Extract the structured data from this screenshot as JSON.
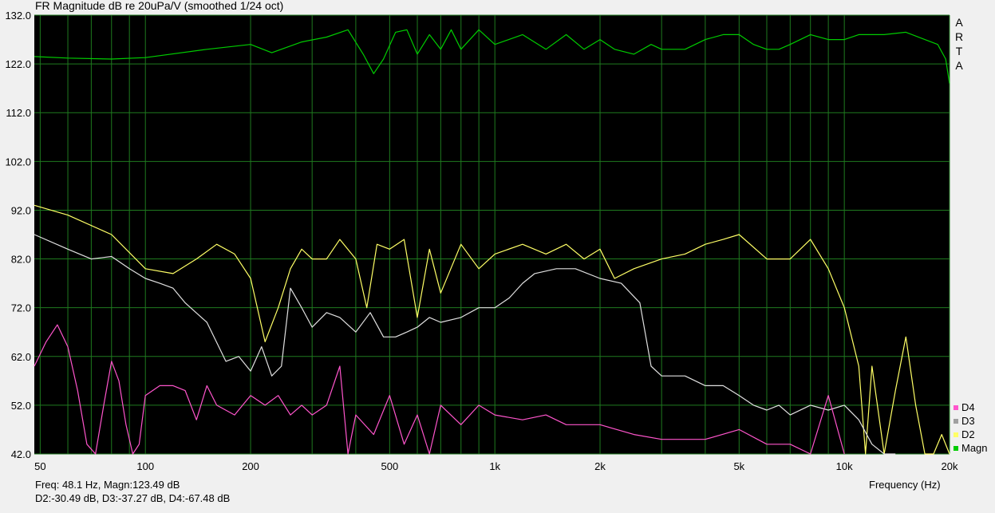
{
  "title": "FR Magnitude dB re 20uPa/V (smoothed 1/24 oct)",
  "brand_letters": [
    "A",
    "R",
    "T",
    "A"
  ],
  "readout": {
    "line1": "Freq: 48.1 Hz, Magn:123.49 dB",
    "line2": "D2:-30.49 dB, D3:-37.27 dB, D4:-67.48 dB"
  },
  "legend": [
    {
      "label": "D4",
      "color": "#ff55cc"
    },
    {
      "label": "D3",
      "color": "#a0a0a0"
    },
    {
      "label": "D2",
      "color": "#ffff66"
    },
    {
      "label": "Magn",
      "color": "#00cc00"
    }
  ],
  "chart_data": {
    "type": "line",
    "title": "FR Magnitude dB re 20uPa/V (smoothed 1/24 oct)",
    "xlabel": "Frequency (Hz)",
    "ylabel": "",
    "xscale": "log",
    "xlim": [
      48.1,
      20000
    ],
    "ylim": [
      42,
      132
    ],
    "grid": true,
    "yticks": [
      "132.0",
      "122.0",
      "112.0",
      "102.0",
      "92.0",
      "82.0",
      "72.0",
      "62.0",
      "52.0",
      "42.0"
    ],
    "ytick_values": [
      132,
      122,
      112,
      102,
      92,
      82,
      72,
      62,
      52,
      42
    ],
    "xticks": [
      {
        "value": 50,
        "label": "50"
      },
      {
        "value": 100,
        "label": "100"
      },
      {
        "value": 200,
        "label": "200"
      },
      {
        "value": 500,
        "label": "500"
      },
      {
        "value": 1000,
        "label": "1k"
      },
      {
        "value": 2000,
        "label": "2k"
      },
      {
        "value": 5000,
        "label": "5k"
      },
      {
        "value": 10000,
        "label": "10k"
      },
      {
        "value": 20000,
        "label": "20k"
      }
    ],
    "colors": {
      "background": "#000000",
      "grid": "#1f7a1f"
    },
    "series": [
      {
        "name": "Magn",
        "color": "#00cc00",
        "x": [
          48.1,
          60,
          80,
          100,
          150,
          200,
          230,
          280,
          330,
          380,
          420,
          450,
          480,
          520,
          560,
          600,
          650,
          700,
          750,
          800,
          900,
          1000,
          1200,
          1400,
          1600,
          1800,
          2000,
          2200,
          2500,
          2800,
          3000,
          3500,
          4000,
          4500,
          5000,
          5500,
          6000,
          6500,
          7000,
          8000,
          9000,
          10000,
          11000,
          12000,
          13000,
          15000,
          17000,
          18500,
          19500,
          20000
        ],
        "y": [
          123.5,
          123.2,
          123,
          123.3,
          125,
          126,
          124.3,
          126.5,
          127.5,
          129,
          124,
          120,
          123,
          128.5,
          129,
          124,
          128,
          125,
          129,
          125,
          129,
          126,
          128,
          125,
          128,
          125,
          127,
          125,
          124,
          126,
          125,
          125,
          127,
          128,
          128,
          126,
          125,
          125,
          126,
          128,
          127,
          127,
          128,
          128,
          128,
          128.5,
          127,
          126,
          123,
          118
        ]
      },
      {
        "name": "D2",
        "color": "#ffff66",
        "x": [
          48.1,
          60,
          80,
          100,
          120,
          140,
          160,
          180,
          200,
          220,
          240,
          260,
          280,
          300,
          330,
          360,
          400,
          430,
          460,
          500,
          550,
          600,
          650,
          700,
          800,
          900,
          1000,
          1200,
          1400,
          1600,
          1800,
          2000,
          2200,
          2500,
          3000,
          3500,
          4000,
          4500,
          5000,
          6000,
          7000,
          8000,
          9000,
          10000,
          11000,
          11500,
          12000,
          13000,
          14000,
          15000,
          16000,
          17000,
          18000,
          19000,
          20000
        ],
        "y": [
          93,
          91,
          87,
          80,
          79,
          82,
          85,
          83,
          78,
          65,
          72,
          80,
          84,
          82,
          82,
          86,
          82,
          72,
          85,
          84,
          86,
          70,
          84,
          75,
          85,
          80,
          83,
          85,
          83,
          85,
          82,
          84,
          78,
          80,
          82,
          83,
          85,
          86,
          87,
          82,
          82,
          86,
          80,
          72,
          60,
          40,
          60,
          42,
          55,
          66,
          52,
          42,
          40,
          46,
          42
        ]
      },
      {
        "name": "D3",
        "color": "#e0e0e0",
        "x": [
          48.1,
          60,
          70,
          80,
          90,
          100,
          110,
          120,
          130,
          150,
          170,
          185,
          200,
          215,
          230,
          245,
          260,
          280,
          300,
          330,
          360,
          400,
          440,
          480,
          520,
          560,
          600,
          650,
          700,
          800,
          900,
          1000,
          1100,
          1200,
          1300,
          1500,
          1700,
          2000,
          2300,
          2600,
          2800,
          3000,
          3500,
          4000,
          4500,
          5000,
          5500,
          6000,
          6500,
          7000,
          8000,
          9000,
          10000,
          11000,
          12000,
          13000,
          14000
        ],
        "y": [
          87,
          84,
          82,
          82.5,
          80,
          78,
          77,
          76,
          73,
          69,
          61,
          62,
          59,
          64,
          58,
          60,
          76,
          72,
          68,
          71,
          70,
          67,
          71,
          66,
          66,
          67,
          68,
          70,
          69,
          70,
          72,
          72,
          74,
          77,
          79,
          80,
          80,
          78,
          77,
          73,
          60,
          58,
          58,
          56,
          56,
          54,
          52,
          51,
          52,
          50,
          52,
          51,
          52,
          49,
          44,
          42,
          41
        ]
      },
      {
        "name": "D4",
        "color": "#ff55cc",
        "x": [
          48.1,
          52,
          56,
          60,
          64,
          68,
          72,
          76,
          80,
          84,
          88,
          92,
          96,
          100,
          110,
          120,
          130,
          140,
          150,
          160,
          180,
          200,
          220,
          240,
          260,
          280,
          300,
          330,
          360,
          380,
          400,
          450,
          500,
          550,
          600,
          650,
          700,
          800,
          900,
          1000,
          1200,
          1400,
          1600,
          2000,
          2500,
          3000,
          4000,
          5000,
          6000,
          7000,
          8000,
          9000,
          10000
        ],
        "y": [
          60,
          65,
          68.5,
          64,
          55,
          44,
          42,
          52,
          61,
          57,
          48,
          42,
          44,
          54,
          56,
          56,
          55,
          49,
          56,
          52,
          50,
          54,
          52,
          54,
          50,
          52,
          50,
          52,
          60,
          42,
          50,
          46,
          54,
          44,
          50,
          42,
          52,
          48,
          52,
          50,
          49,
          50,
          48,
          48,
          46,
          45,
          45,
          47,
          44,
          44,
          42,
          54,
          40
        ]
      }
    ]
  }
}
